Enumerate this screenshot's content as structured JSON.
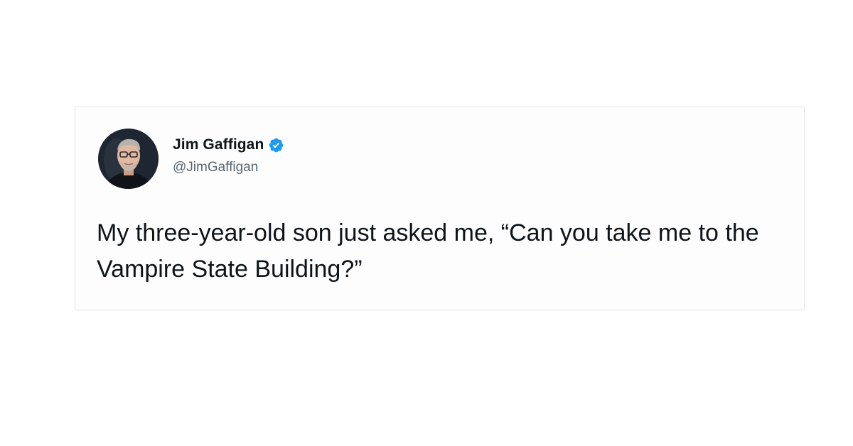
{
  "tweet": {
    "author": {
      "display_name": "Jim Gaffigan",
      "handle": "@JimGaffigan",
      "verified": true,
      "avatar_icon": "profile-photo"
    },
    "text": "My three-year-old son just asked me, “Can you take me to the Vampire State Building?”"
  },
  "colors": {
    "verified_badge": "#1d9bf0",
    "name": "#0f1419",
    "handle": "#5b6770",
    "card_background": "#fdfdfd",
    "card_border": "#e6e6e6"
  }
}
